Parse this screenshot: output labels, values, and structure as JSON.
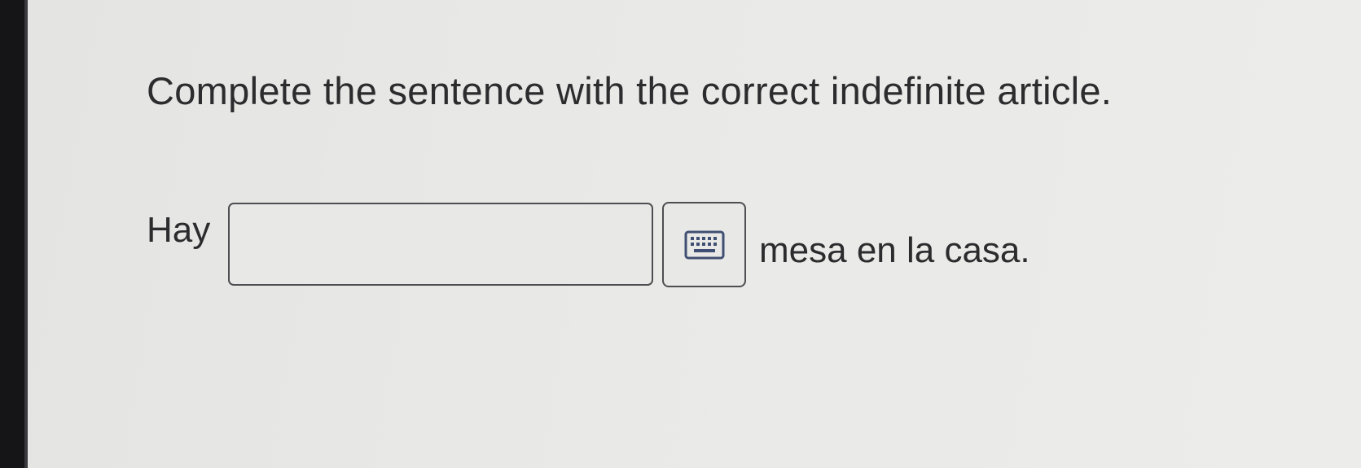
{
  "question": {
    "prompt": "Complete the sentence with the correct indefinite article.",
    "sentence_before": "Hay",
    "sentence_after": "mesa en la casa."
  },
  "answer_input": {
    "value": "",
    "placeholder": ""
  },
  "keyboard_button": {
    "icon": "keyboard-icon"
  }
}
